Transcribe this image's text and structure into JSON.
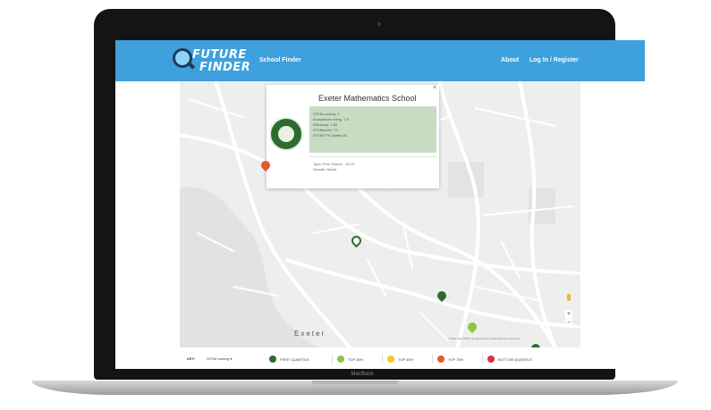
{
  "device": {
    "brand_label": "MacBook"
  },
  "app": {
    "logo": {
      "line1": "FUTURE",
      "line2": "FINDER"
    },
    "nav": {
      "school_finder": "School Finder",
      "about": "About",
      "login": "Log In / Register"
    }
  },
  "map": {
    "place_label": "Exeter",
    "attribution": "© Map data ©2017 Google   Terms of Use   Report a map error",
    "zoom_in": "+",
    "zoom_out": "−",
    "info_card": {
      "close": "×",
      "school_name": "Exeter Mathematics School",
      "ratings": [
        "STEM ranking: 1",
        "Acceptance rating: 7.5",
        "Efficiency: 1.00",
        "STEMscore: 73",
        "STEM FTE (state) 45"
      ],
      "details": [
        "Type: Free School · 16-19",
        "Gender: Mixed"
      ]
    },
    "markers": [
      {
        "category": "dark-green",
        "color": "#2e6b30"
      },
      {
        "category": "light-green",
        "color": "#8cc63f"
      },
      {
        "category": "orange",
        "color": "#e8562a"
      },
      {
        "category": "selected",
        "color": "#2e6b30"
      }
    ]
  },
  "key": {
    "label": "KEY:",
    "dropdown": "STEM ranking ▾",
    "items": [
      {
        "label": "FIRST QUARTILE",
        "color": "#2e6b30"
      },
      {
        "label": "TOP 25%",
        "color": "#8cc63f"
      },
      {
        "label": "TOP 50%",
        "color": "#f2c532"
      },
      {
        "label": "TOP 75%",
        "color": "#e8562a"
      },
      {
        "label": "BOTTOM QUARTILE",
        "color": "#d6333b"
      }
    ]
  }
}
